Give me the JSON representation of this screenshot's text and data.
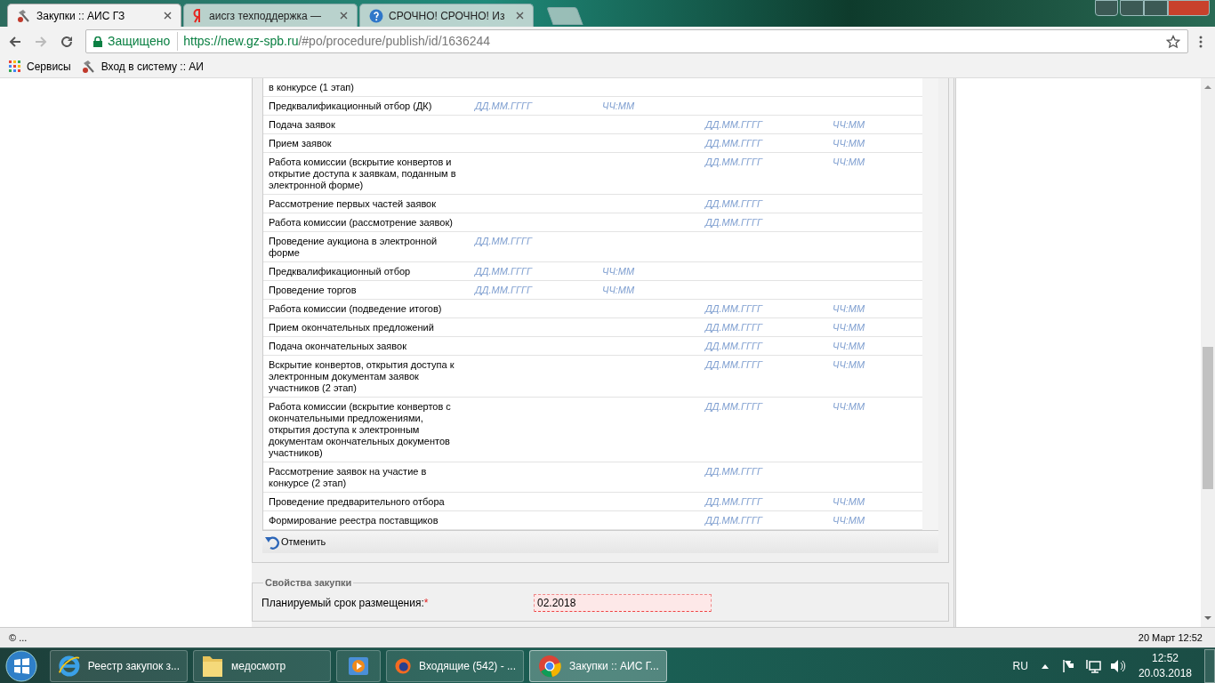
{
  "browser_tabs": [
    {
      "title": "Закупки :: АИС ГЗ",
      "selected": true,
      "kind": "tool"
    },
    {
      "title": "аисгз техподдержка —",
      "selected": false,
      "kind": "yandex"
    },
    {
      "title": "СРОЧНО! СРОЧНО! Из",
      "selected": false,
      "kind": "help"
    }
  ],
  "address_bar": {
    "security": "Защищено",
    "url_host": "https://new.gz-spb.ru",
    "url_path": "/#po/procedure/publish/id/1636244"
  },
  "bookmarks": [
    {
      "label": "Сервисы",
      "kind": "apps"
    },
    {
      "label": "Вход в систему :: АИ",
      "kind": "tool"
    }
  ],
  "schedule_table": {
    "rows": [
      {
        "label": "в конкурсе (1 этап)"
      },
      {
        "label": "Предквалификационный отбор (ДК)",
        "column_2": "ДД.ММ.ГГГГ",
        "column_3": "ЧЧ:ММ"
      },
      {
        "label": "Подача заявок",
        "column_4": "ДД.ММ.ГГГГ",
        "column_5": "ЧЧ:ММ"
      },
      {
        "label": "Прием заявок",
        "column_4": "ДД.ММ.ГГГГ",
        "column_5": "ЧЧ:ММ"
      },
      {
        "label": "Работа комиссии (вскрытие конвертов и открытие доступа к заявкам, поданным в электронной форме)",
        "column_4": "ДД.ММ.ГГГГ",
        "column_5": "ЧЧ:ММ"
      },
      {
        "label": "Рассмотрение первых частей заявок",
        "column_4": "ДД.ММ.ГГГГ"
      },
      {
        "label": "Работа комиссии (рассмотрение заявок)",
        "column_4": "ДД.ММ.ГГГГ"
      },
      {
        "label": "Проведение аукциона в электронной форме",
        "column_2": "ДД.ММ.ГГГГ"
      },
      {
        "label": "Предквалификационный отбор",
        "column_2": "ДД.ММ.ГГГГ",
        "column_3": "ЧЧ:ММ"
      },
      {
        "label": "Проведение торгов",
        "column_2": "ДД.ММ.ГГГГ",
        "column_3": "ЧЧ:ММ"
      },
      {
        "label": "Работа комиссии (подведение итогов)",
        "column_4": "ДД.ММ.ГГГГ",
        "column_5": "ЧЧ:ММ"
      },
      {
        "label": "Прием окончательных предложений",
        "column_4": "ДД.ММ.ГГГГ",
        "column_5": "ЧЧ:ММ"
      },
      {
        "label": "Подача окончательных заявок",
        "column_4": "ДД.ММ.ГГГГ",
        "column_5": "ЧЧ:ММ"
      },
      {
        "label": "Вскрытие конвертов, открытия доступа к электронным документам заявок участников (2 этап)",
        "column_4": "ДД.ММ.ГГГГ",
        "column_5": "ЧЧ:ММ"
      },
      {
        "label": "Работа комиссии (вскрытие конвертов с окончательными предложениями, открытия доступа к электронным документам окончательных документов участников)",
        "column_4": "ДД.ММ.ГГГГ",
        "column_5": "ЧЧ:ММ"
      },
      {
        "label": "Рассмотрение заявок на участие в конкурсе (2 этап)",
        "column_4": "ДД.ММ.ГГГГ"
      },
      {
        "label": "Проведение предварительного отбора",
        "column_4": "ДД.ММ.ГГГГ",
        "column_5": "ЧЧ:ММ"
      },
      {
        "label": "Формирование реестра поставщиков",
        "column_4": "ДД.ММ.ГГГГ",
        "column_5": "ЧЧ:ММ"
      }
    ],
    "cancel_button": "Отменить"
  },
  "procurement_properties": {
    "legend": "Свойства закупки",
    "fields": [
      {
        "label": "Планируемый срок размещения:",
        "required_mark": "*",
        "value": "02.2018",
        "invalid": true
      }
    ]
  },
  "status_bar": {
    "left": "© ...",
    "right": "20 Март 12:52"
  },
  "taskbar": {
    "items": [
      {
        "label": "Реестр закупок з...",
        "kind": "ie",
        "selected": false
      },
      {
        "label": "медосмотр",
        "kind": "folder",
        "selected": false
      },
      {
        "kind": "media",
        "selected": false
      },
      {
        "label": "Входящие (542) - ...",
        "kind": "firefox",
        "selected": false
      },
      {
        "label": "Закупки :: АИС Г...",
        "kind": "chrome",
        "selected": true
      }
    ],
    "language": "RU",
    "time": "12:52",
    "date": "20.03.2018"
  }
}
